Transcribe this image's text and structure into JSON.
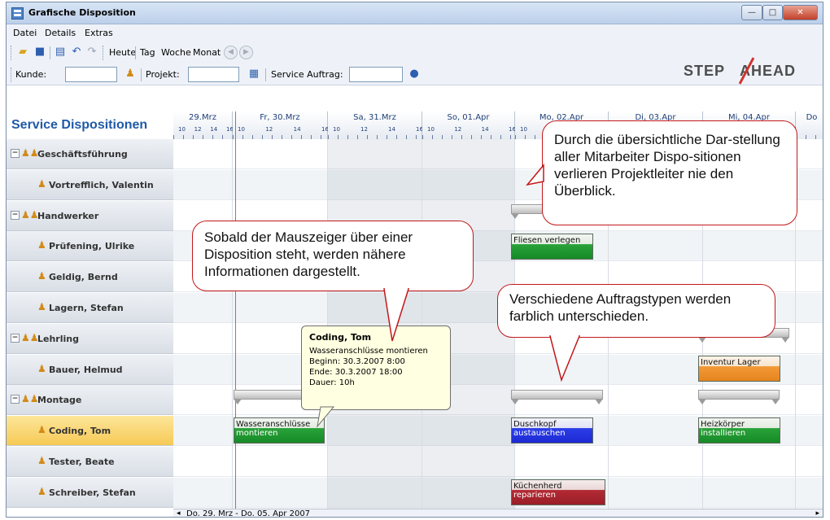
{
  "window": {
    "title": "Grafische Disposition"
  },
  "menu": [
    "Datei",
    "Details",
    "Extras"
  ],
  "toolbar": {
    "heute": "Heute",
    "tag": "Tag",
    "woche": "Woche",
    "monat": "Monat"
  },
  "filters": {
    "kunde": "Kunde:",
    "projekt": "Projekt:",
    "service_auftrag": "Service Auftrag:"
  },
  "logo": {
    "left": "STEP",
    "right": "AHEAD"
  },
  "panel_title": "Service Dispositionen",
  "days": [
    {
      "label": "29.Mrz"
    },
    {
      "label": "Fr, 30.Mrz"
    },
    {
      "label": "Sa, 31.Mrz"
    },
    {
      "label": "So, 01.Apr"
    },
    {
      "label": "Mo, 02.Apr"
    },
    {
      "label": "Di, 03.Apr"
    },
    {
      "label": "Mi, 04.Apr"
    },
    {
      "label": "Do"
    }
  ],
  "hours": [
    "10",
    "12",
    "14",
    "16"
  ],
  "rows": [
    {
      "type": "group",
      "label": "Geschäftsführung"
    },
    {
      "type": "person",
      "label": "Vortrefflich, Valentin"
    },
    {
      "type": "group",
      "label": "Handwerker"
    },
    {
      "type": "person",
      "label": "Prüfening, Ulrike"
    },
    {
      "type": "person",
      "label": "Geldig, Bernd"
    },
    {
      "type": "person",
      "label": "Lagern, Stefan"
    },
    {
      "type": "group",
      "label": "Lehrling"
    },
    {
      "type": "person",
      "label": "Bauer, Helmud"
    },
    {
      "type": "group",
      "label": "Montage"
    },
    {
      "type": "person",
      "label": "Coding, Tom",
      "selected": true
    },
    {
      "type": "person",
      "label": "Tester, Beate"
    },
    {
      "type": "person",
      "label": "Schreiber, Stefan"
    }
  ],
  "tasks": [
    {
      "line1": "Fliesen verlegen",
      "line2": "",
      "color": "green"
    },
    {
      "line1": "Inventur Lager",
      "line2": "",
      "color": "orange"
    },
    {
      "line1": "Wasseranschlüsse",
      "line2": "montieren",
      "color": "green"
    },
    {
      "line1": "Duschkopf",
      "line2": "austauschen",
      "color": "blue"
    },
    {
      "line1": "Heizkörper",
      "line2": "installieren",
      "color": "green"
    },
    {
      "line1": "Küchenherd",
      "line2": "reparieren",
      "color": "red"
    }
  ],
  "tooltip": {
    "title": "Coding, Tom",
    "line1": "Wasseranschlüsse montieren",
    "line2": "Beginn: 30.3.2007 8:00",
    "line3": "Ende: 30.3.2007 18:00",
    "line4": "Dauer: 10h"
  },
  "callouts": {
    "overview": "Durch die übersichtliche Dar-stellung aller Mitarbeiter Dispo-sitionen verlieren Projektleiter nie den Überblick.",
    "mouse": "Sobald der Mauszeiger über einer Disposition steht, werden nähere Informationen dargestellt.",
    "types": "Verschiedene Auftragstypen werden farblich unterschieden."
  },
  "status": "Do. 29. Mrz - Do. 05. Apr 2007"
}
